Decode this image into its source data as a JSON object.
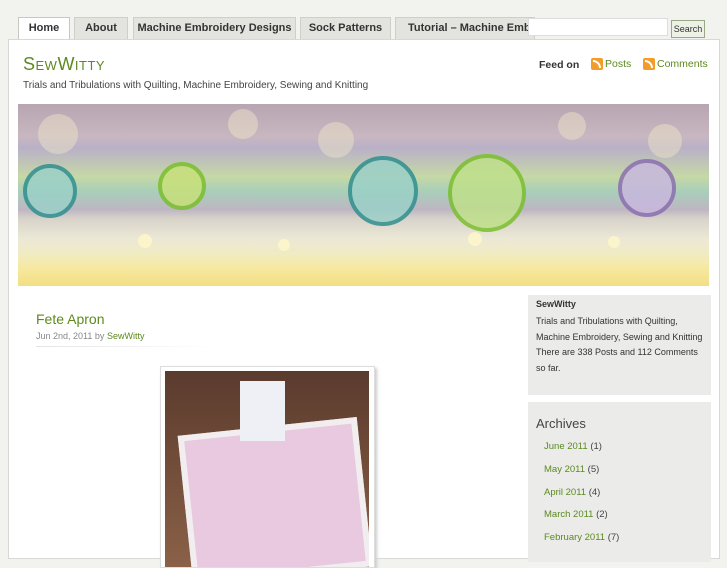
{
  "nav": {
    "tabs": [
      {
        "label": "Home",
        "active": true
      },
      {
        "label": "About"
      },
      {
        "label": "Machine Embroidery Designs"
      },
      {
        "label": "Sock Patterns"
      },
      {
        "label": "Tutorial – Machine Embroidery"
      }
    ],
    "search": {
      "value": "",
      "button_label": "Search"
    }
  },
  "site": {
    "title": "SewWitty",
    "description": "Trials and Tribulations with Quilting, Machine Embroidery, Sewing and Knitting"
  },
  "feeds": {
    "label": "Feed on",
    "posts_label": "Posts",
    "comments_label": "Comments",
    "icon": "rss-icon"
  },
  "post": {
    "title": "Fete Apron",
    "date": "Jun 2nd, 2011",
    "by": "by",
    "author": "SewWitty"
  },
  "sidebar": {
    "about": {
      "name": "SewWitty",
      "text": "Trials and Tribulations with Quilting, Machine Embroidery, Sewing and Knitting",
      "stats": "There are 338 Posts and 112 Comments so far."
    },
    "archives": {
      "heading": "Archives",
      "items": [
        {
          "label": "June 2011",
          "count": "(1)"
        },
        {
          "label": "May 2011",
          "count": "(5)"
        },
        {
          "label": "April 2011",
          "count": "(4)"
        },
        {
          "label": "March 2011",
          "count": "(2)"
        },
        {
          "label": "February 2011",
          "count": "(7)"
        }
      ]
    }
  },
  "colors": {
    "accent": "#5c8a1f",
    "rss": "#f39c2b"
  }
}
